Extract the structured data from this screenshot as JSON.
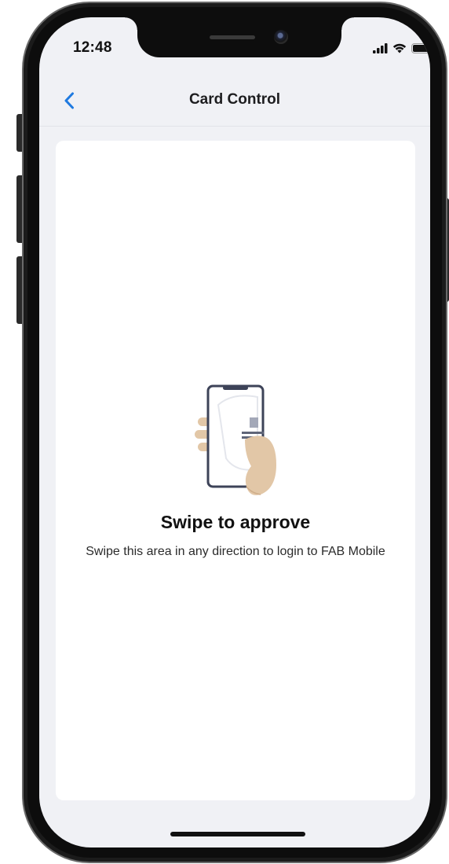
{
  "status_bar": {
    "time": "12:48",
    "signal_icon": "cellular-signal-icon",
    "wifi_icon": "wifi-icon",
    "battery_icon": "battery-icon"
  },
  "nav": {
    "back_icon": "chevron-left-icon",
    "title": "Card Control"
  },
  "card": {
    "illustration_icon": "hand-holding-phone-illustration",
    "title": "Swipe to approve",
    "description": "Swipe this area in any direction to login to FAB Mobile"
  },
  "colors": {
    "accent": "#1f7ae0",
    "screen_background": "#f0f1f5",
    "card_background": "#ffffff",
    "skin_tone": "#e2c7a7"
  }
}
